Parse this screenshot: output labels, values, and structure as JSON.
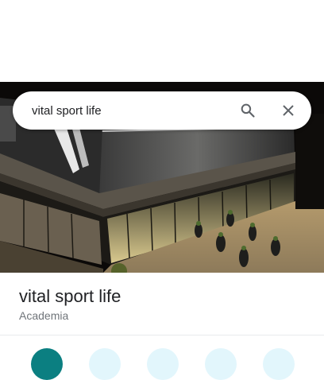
{
  "search": {
    "query": "vital sport life"
  },
  "place": {
    "name": "vital sport life",
    "category": "Academia"
  },
  "icons": {
    "search": "search-icon",
    "close": "close-icon"
  },
  "colors": {
    "primary_action": "#0b7f81",
    "secondary_action": "#e2f6fc",
    "title": "#202124",
    "subtitle": "#70757a"
  },
  "actions": [
    "directions-button",
    "start-button",
    "call-button",
    "save-button",
    "share-button"
  ]
}
